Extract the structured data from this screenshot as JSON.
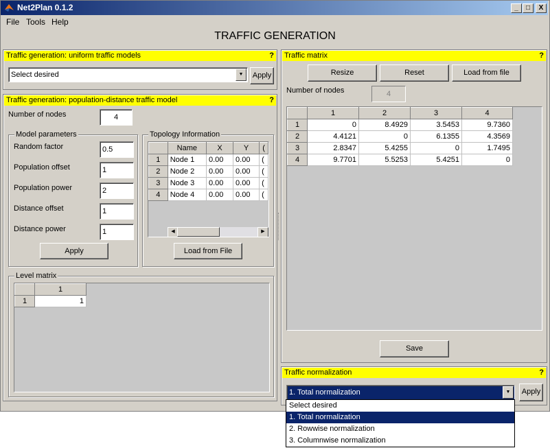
{
  "window": {
    "title": "Net2Plan 0.1.2",
    "min_glyph": "_",
    "max_glyph": "□",
    "close_glyph": "X"
  },
  "menu": {
    "file": "File",
    "tools": "Tools",
    "help": "Help"
  },
  "page_title": "TRAFFIC GENERATION",
  "help_glyph": "?",
  "uniform": {
    "header": "Traffic generation: uniform traffic models",
    "select_value": "Select desired",
    "apply_label": "Apply"
  },
  "popdist": {
    "header": "Traffic generation: population-distance traffic model",
    "num_nodes_label": "Number of nodes",
    "num_nodes_value": "4",
    "model_params_title": "Model parameters",
    "params": [
      {
        "label": "Random factor",
        "value": "0.5"
      },
      {
        "label": "Population offset",
        "value": "1"
      },
      {
        "label": "Population power",
        "value": "2"
      },
      {
        "label": "Distance offset",
        "value": "1"
      },
      {
        "label": "Distance power",
        "value": "1"
      }
    ],
    "apply_label": "Apply",
    "topology_title": "Topology Information",
    "topology_columns": [
      "Name",
      "X",
      "Y",
      "("
    ],
    "topology_rows": [
      {
        "idx": "1",
        "name": "Node 1",
        "x": "0.00",
        "y": "0.00",
        "z": "("
      },
      {
        "idx": "2",
        "name": "Node 2",
        "x": "0.00",
        "y": "0.00",
        "z": "("
      },
      {
        "idx": "3",
        "name": "Node 3",
        "x": "0.00",
        "y": "0.00",
        "z": "("
      },
      {
        "idx": "4",
        "name": "Node 4",
        "x": "0.00",
        "y": "0.00",
        "z": "("
      }
    ],
    "load_label": "Load from File",
    "level_title": "Level matrix",
    "level_col": "1",
    "level_row": "1",
    "level_value": "1"
  },
  "tm": {
    "header": "Traffic matrix",
    "resize_label": "Resize",
    "reset_label": "Reset",
    "load_label": "Load from file",
    "num_nodes_label": "Number of nodes",
    "num_nodes_value": "4",
    "columns": [
      "1",
      "2",
      "3",
      "4"
    ],
    "rows": [
      {
        "idx": "1",
        "vals": [
          "0",
          "8.4929",
          "3.5453",
          "9.7360"
        ]
      },
      {
        "idx": "2",
        "vals": [
          "4.4121",
          "0",
          "6.1355",
          "4.3569"
        ]
      },
      {
        "idx": "3",
        "vals": [
          "2.8347",
          "5.4255",
          "0",
          "1.7495"
        ]
      },
      {
        "idx": "4",
        "vals": [
          "9.7701",
          "5.5253",
          "5.4251",
          "0"
        ]
      }
    ],
    "save_label": "Save"
  },
  "norm": {
    "header": "Traffic normalization",
    "select_value": "1. Total normalization",
    "apply_label": "Apply",
    "options": [
      "Select desired",
      "1. Total normalization",
      "2. Rowwise normalization",
      "3. Columnwise normalization"
    ]
  },
  "colors": {
    "header_yellow": "#ffff00",
    "selection": "#0a246a",
    "window_bg": "#d4d0c8"
  }
}
